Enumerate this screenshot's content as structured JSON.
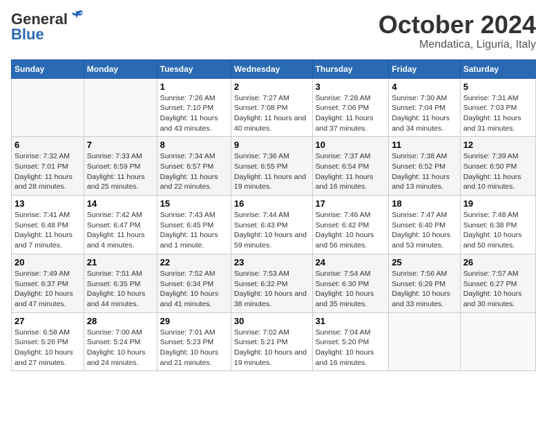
{
  "header": {
    "logo_general": "General",
    "logo_blue": "Blue",
    "month_year": "October 2024",
    "location": "Mendatica, Liguria, Italy"
  },
  "weekdays": [
    "Sunday",
    "Monday",
    "Tuesday",
    "Wednesday",
    "Thursday",
    "Friday",
    "Saturday"
  ],
  "weeks": [
    [
      {
        "day": "",
        "info": ""
      },
      {
        "day": "",
        "info": ""
      },
      {
        "day": "1",
        "info": "Sunrise: 7:26 AM\nSunset: 7:10 PM\nDaylight: 11 hours and 43 minutes."
      },
      {
        "day": "2",
        "info": "Sunrise: 7:27 AM\nSunset: 7:08 PM\nDaylight: 11 hours and 40 minutes."
      },
      {
        "day": "3",
        "info": "Sunrise: 7:28 AM\nSunset: 7:06 PM\nDaylight: 11 hours and 37 minutes."
      },
      {
        "day": "4",
        "info": "Sunrise: 7:30 AM\nSunset: 7:04 PM\nDaylight: 11 hours and 34 minutes."
      },
      {
        "day": "5",
        "info": "Sunrise: 7:31 AM\nSunset: 7:03 PM\nDaylight: 11 hours and 31 minutes."
      }
    ],
    [
      {
        "day": "6",
        "info": "Sunrise: 7:32 AM\nSunset: 7:01 PM\nDaylight: 11 hours and 28 minutes."
      },
      {
        "day": "7",
        "info": "Sunrise: 7:33 AM\nSunset: 6:59 PM\nDaylight: 11 hours and 25 minutes."
      },
      {
        "day": "8",
        "info": "Sunrise: 7:34 AM\nSunset: 6:57 PM\nDaylight: 11 hours and 22 minutes."
      },
      {
        "day": "9",
        "info": "Sunrise: 7:36 AM\nSunset: 6:55 PM\nDaylight: 11 hours and 19 minutes."
      },
      {
        "day": "10",
        "info": "Sunrise: 7:37 AM\nSunset: 6:54 PM\nDaylight: 11 hours and 16 minutes."
      },
      {
        "day": "11",
        "info": "Sunrise: 7:38 AM\nSunset: 6:52 PM\nDaylight: 11 hours and 13 minutes."
      },
      {
        "day": "12",
        "info": "Sunrise: 7:39 AM\nSunset: 6:50 PM\nDaylight: 11 hours and 10 minutes."
      }
    ],
    [
      {
        "day": "13",
        "info": "Sunrise: 7:41 AM\nSunset: 6:48 PM\nDaylight: 11 hours and 7 minutes."
      },
      {
        "day": "14",
        "info": "Sunrise: 7:42 AM\nSunset: 6:47 PM\nDaylight: 11 hours and 4 minutes."
      },
      {
        "day": "15",
        "info": "Sunrise: 7:43 AM\nSunset: 6:45 PM\nDaylight: 11 hours and 1 minute."
      },
      {
        "day": "16",
        "info": "Sunrise: 7:44 AM\nSunset: 6:43 PM\nDaylight: 10 hours and 59 minutes."
      },
      {
        "day": "17",
        "info": "Sunrise: 7:46 AM\nSunset: 6:42 PM\nDaylight: 10 hours and 56 minutes."
      },
      {
        "day": "18",
        "info": "Sunrise: 7:47 AM\nSunset: 6:40 PM\nDaylight: 10 hours and 53 minutes."
      },
      {
        "day": "19",
        "info": "Sunrise: 7:48 AM\nSunset: 6:38 PM\nDaylight: 10 hours and 50 minutes."
      }
    ],
    [
      {
        "day": "20",
        "info": "Sunrise: 7:49 AM\nSunset: 6:37 PM\nDaylight: 10 hours and 47 minutes."
      },
      {
        "day": "21",
        "info": "Sunrise: 7:51 AM\nSunset: 6:35 PM\nDaylight: 10 hours and 44 minutes."
      },
      {
        "day": "22",
        "info": "Sunrise: 7:52 AM\nSunset: 6:34 PM\nDaylight: 10 hours and 41 minutes."
      },
      {
        "day": "23",
        "info": "Sunrise: 7:53 AM\nSunset: 6:32 PM\nDaylight: 10 hours and 38 minutes."
      },
      {
        "day": "24",
        "info": "Sunrise: 7:54 AM\nSunset: 6:30 PM\nDaylight: 10 hours and 35 minutes."
      },
      {
        "day": "25",
        "info": "Sunrise: 7:56 AM\nSunset: 6:29 PM\nDaylight: 10 hours and 33 minutes."
      },
      {
        "day": "26",
        "info": "Sunrise: 7:57 AM\nSunset: 6:27 PM\nDaylight: 10 hours and 30 minutes."
      }
    ],
    [
      {
        "day": "27",
        "info": "Sunrise: 6:58 AM\nSunset: 5:26 PM\nDaylight: 10 hours and 27 minutes."
      },
      {
        "day": "28",
        "info": "Sunrise: 7:00 AM\nSunset: 5:24 PM\nDaylight: 10 hours and 24 minutes."
      },
      {
        "day": "29",
        "info": "Sunrise: 7:01 AM\nSunset: 5:23 PM\nDaylight: 10 hours and 21 minutes."
      },
      {
        "day": "30",
        "info": "Sunrise: 7:02 AM\nSunset: 5:21 PM\nDaylight: 10 hours and 19 minutes."
      },
      {
        "day": "31",
        "info": "Sunrise: 7:04 AM\nSunset: 5:20 PM\nDaylight: 10 hours and 16 minutes."
      },
      {
        "day": "",
        "info": ""
      },
      {
        "day": "",
        "info": ""
      }
    ]
  ]
}
